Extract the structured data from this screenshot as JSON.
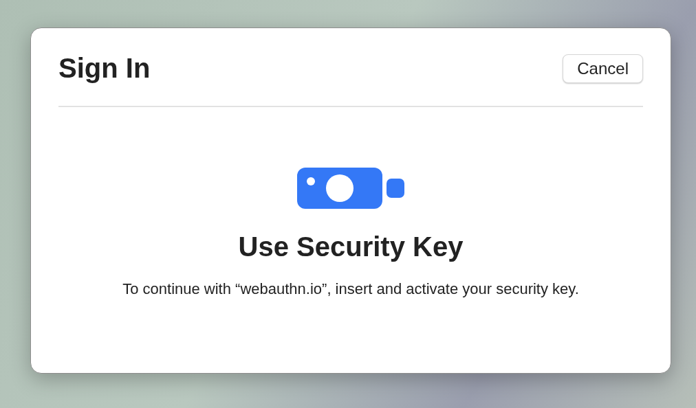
{
  "dialog": {
    "title": "Sign In",
    "cancel_button": "Cancel",
    "heading": "Use Security Key",
    "message": "To continue with “webauthn.io”, insert and activate your security key."
  }
}
